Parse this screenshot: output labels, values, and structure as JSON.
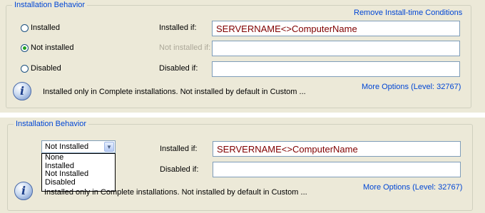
{
  "top": {
    "group_title": "Installation Behavior",
    "remove_link": "Remove Install-time Conditions",
    "radios": [
      {
        "label": "Installed",
        "checked": false
      },
      {
        "label": "Not installed",
        "checked": true
      },
      {
        "label": "Disabled",
        "checked": false
      }
    ],
    "installed_if_label": "Installed if:",
    "installed_if_value": "SERVERNAME<>ComputerName",
    "not_installed_if_label": "Not installed if:",
    "not_installed_if_value": "",
    "disabled_if_label": "Disabled if:",
    "disabled_if_value": "",
    "info_icon": "info-icon",
    "description": "Installed only in Complete installations. Not installed by default in Custom ...",
    "more_options": "More Options (Level: 32767)"
  },
  "bottom": {
    "group_title": "Installation Behavior",
    "combo_value": "Not Installed",
    "combo_options": [
      "None",
      "Installed",
      "Not Installed",
      "Disabled"
    ],
    "installed_if_label": "Installed if:",
    "installed_if_value": "SERVERNAME<>ComputerName",
    "disabled_if_label": "Disabled if:",
    "disabled_if_value": "",
    "info_icon": "info-icon",
    "description": "Installed only in Complete installations. Not installed by default in Custom ...",
    "more_options": "More Options (Level: 32767)"
  },
  "colors": {
    "panel_bg": "#ece9d8",
    "link": "#0046d5",
    "field_text": "#800000"
  }
}
